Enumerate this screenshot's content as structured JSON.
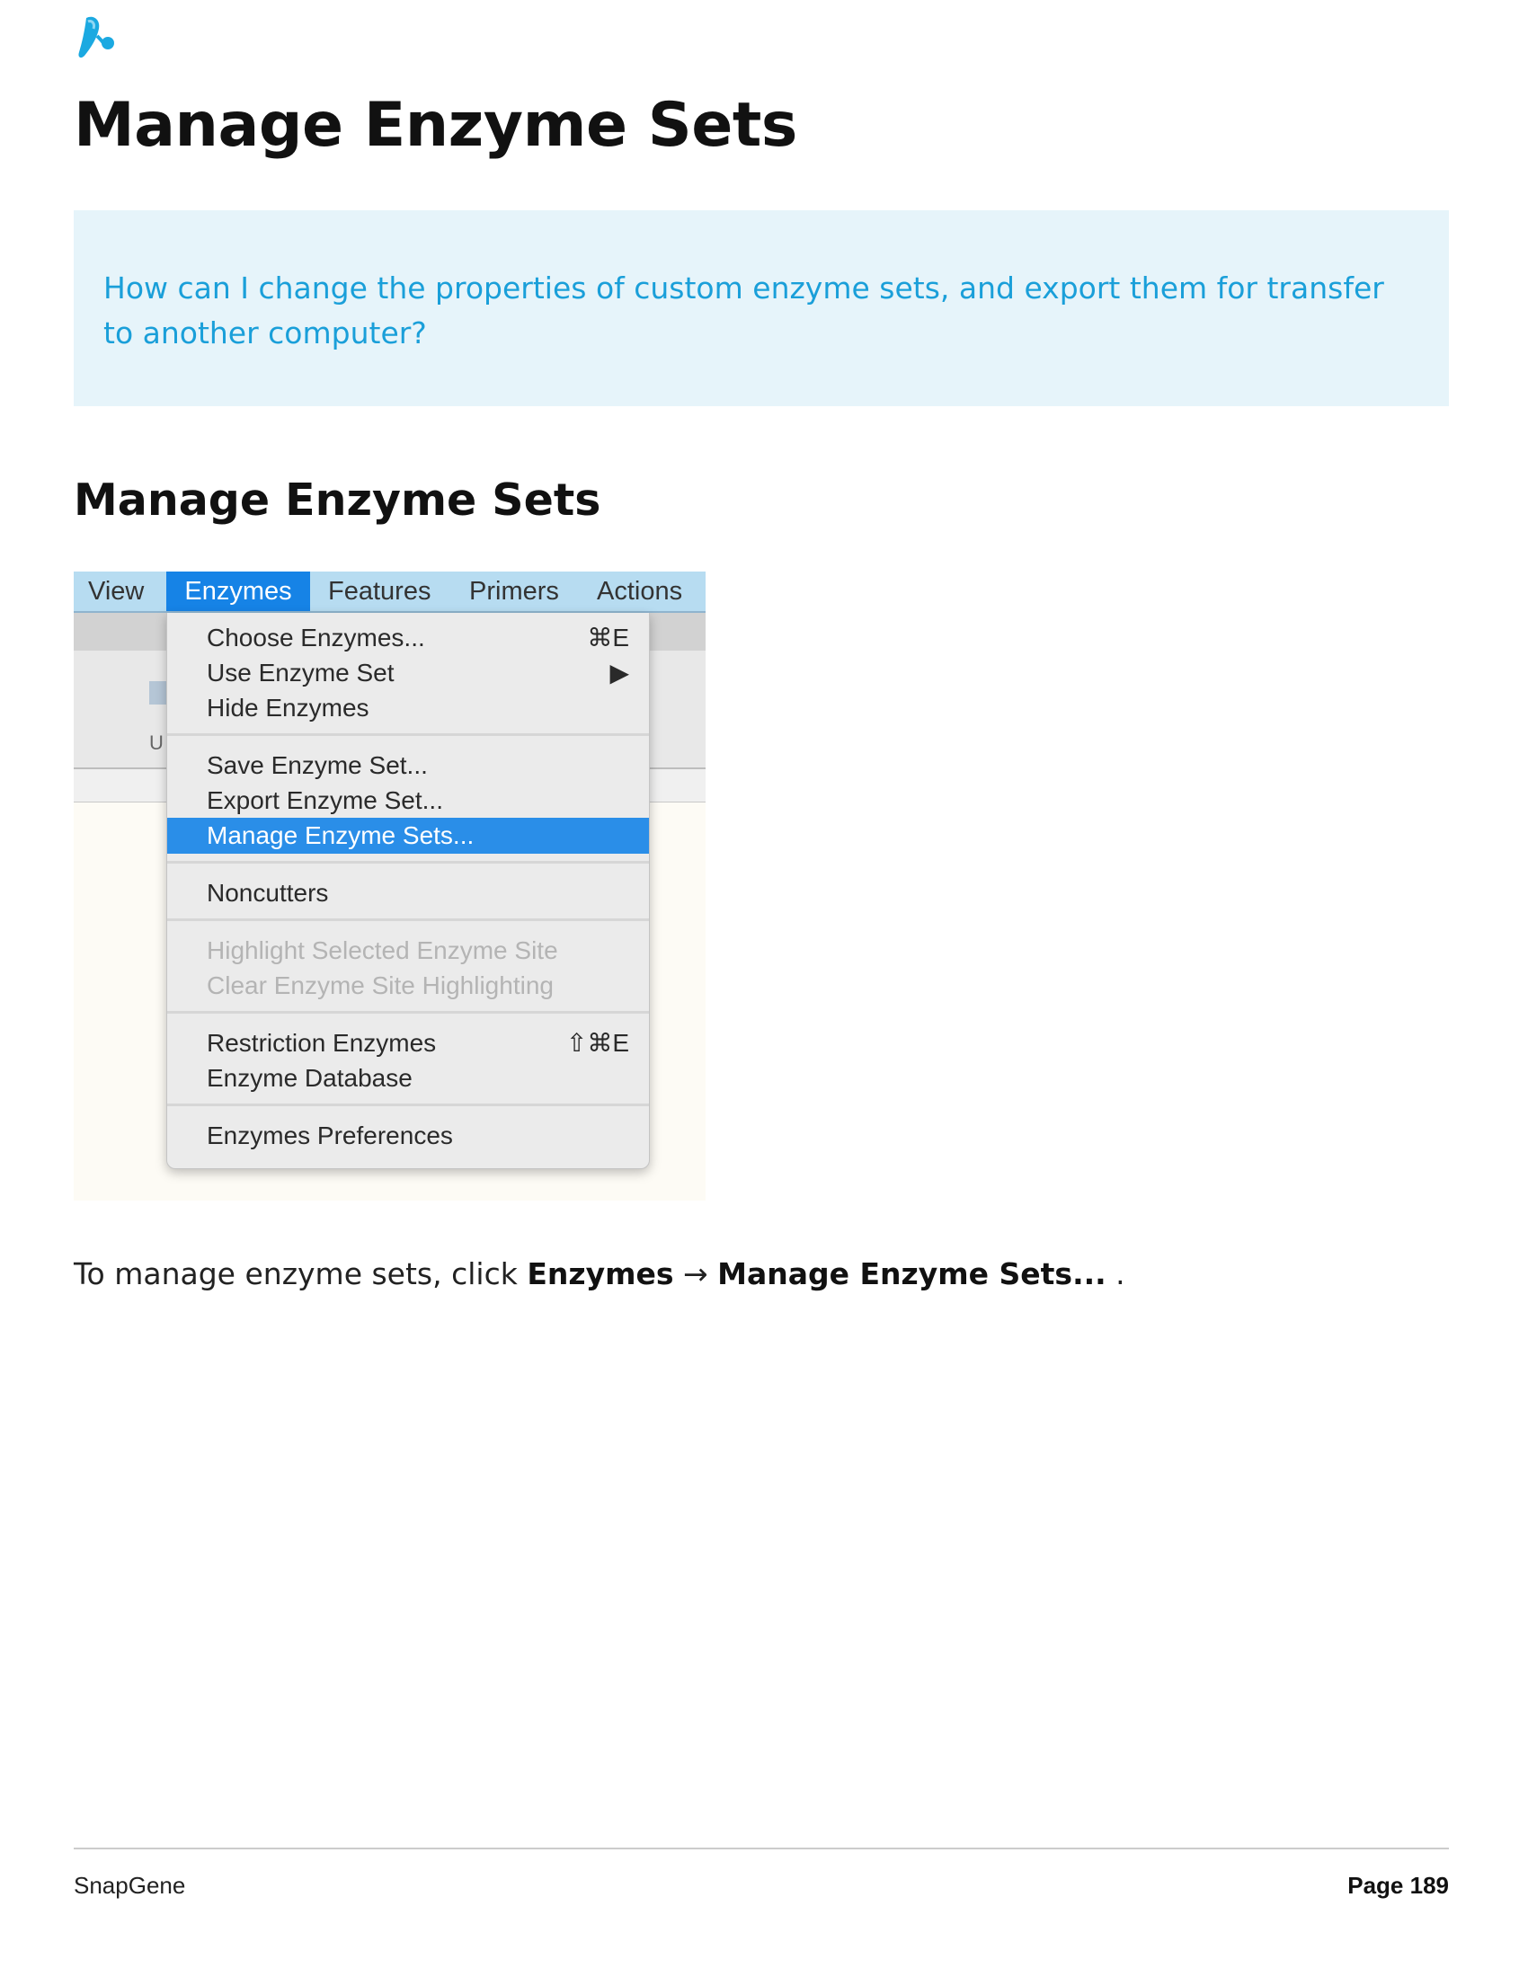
{
  "colors": {
    "accent": "#1a9fd9",
    "callout_bg": "#e6f4fa",
    "menu_highlight": "#1683e6"
  },
  "page": {
    "title": "Manage Enzyme Sets"
  },
  "callout": {
    "text": "How can I change the properties of custom enzyme sets, and export them for transfer to another computer?"
  },
  "section": {
    "heading": "Manage Enzyme Sets"
  },
  "menubar": {
    "items": [
      "View",
      "Enzymes",
      "Features",
      "Primers",
      "Actions"
    ],
    "active": "Enzymes"
  },
  "dropdown": {
    "items": [
      {
        "label": "Choose Enzymes...",
        "shortcut": "⌘E"
      },
      {
        "label": "Use Enzyme Set",
        "shortcut": "▶"
      },
      {
        "label": "Hide Enzymes",
        "shortcut": ""
      },
      {
        "label": "Save Enzyme Set...",
        "shortcut": ""
      },
      {
        "label": "Export Enzyme Set...",
        "shortcut": ""
      },
      {
        "label": "Manage Enzyme Sets...",
        "shortcut": "",
        "selected": true
      },
      {
        "label": "Noncutters",
        "shortcut": ""
      },
      {
        "label": "Highlight Selected Enzyme Site",
        "shortcut": "",
        "disabled": true
      },
      {
        "label": "Clear Enzyme Site Highlighting",
        "shortcut": "",
        "disabled": true
      },
      {
        "label": "Restriction Enzymes",
        "shortcut": "⇧⌘E"
      },
      {
        "label": "Enzyme Database",
        "shortcut": ""
      },
      {
        "label": "Enzymes Preferences",
        "shortcut": ""
      }
    ]
  },
  "background_ghost_letter": "U",
  "instruction": {
    "prefix": "To manage enzyme sets, click ",
    "menu": "Enzymes",
    "arrow": " → ",
    "item": "Manage Enzyme Sets...",
    "suffix": " ."
  },
  "footer": {
    "left": "SnapGene",
    "right": "Page 189"
  }
}
